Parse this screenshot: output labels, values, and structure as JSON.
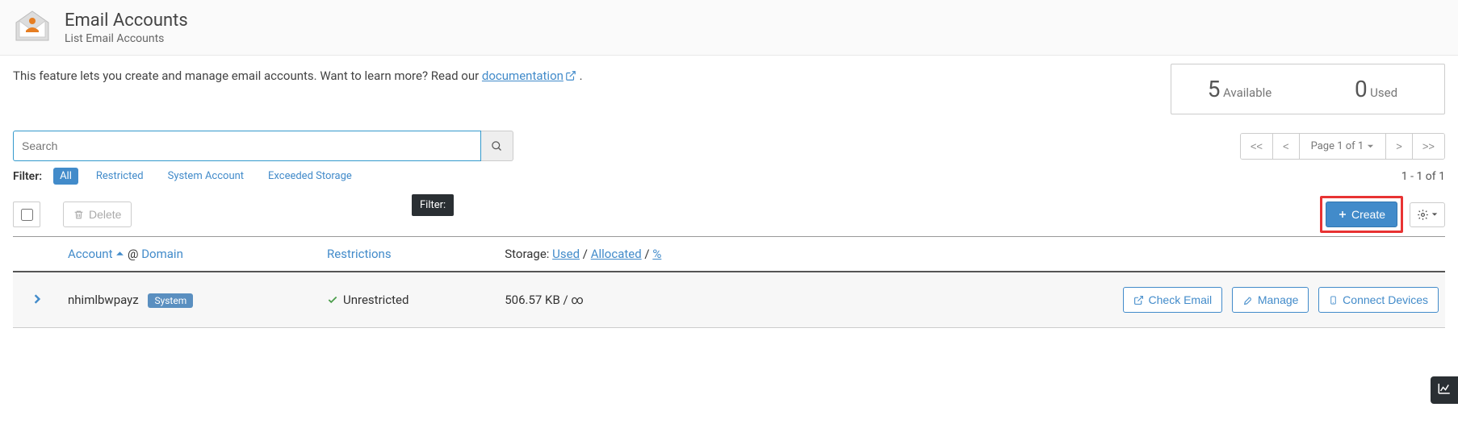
{
  "header": {
    "title": "Email Accounts",
    "subtitle": "List Email Accounts"
  },
  "intro": {
    "text1": "This feature lets you create and manage email accounts. Want to learn more? Read our ",
    "link": "documentation",
    "text2": " ."
  },
  "stats": {
    "available_num": "5",
    "available_lbl": "Available",
    "used_num": "0",
    "used_lbl": "Used"
  },
  "search": {
    "placeholder": "Search"
  },
  "pager": {
    "first": "<<",
    "prev": "<",
    "page_label": "Page 1 of 1",
    "next": ">",
    "last": ">>"
  },
  "filter": {
    "label": "Filter:",
    "all": "All",
    "restricted": "Restricted",
    "system": "System Account",
    "exceeded": "Exceeded Storage",
    "count": "1 - 1 of 1"
  },
  "actions": {
    "delete": "Delete",
    "tooltip": "Filter:",
    "create": "Create"
  },
  "table": {
    "col_account": "Account",
    "col_domain": "Domain",
    "at": "@",
    "col_restrictions": "Restrictions",
    "storage_label": "Storage:",
    "storage_used": "Used",
    "storage_allocated": "Allocated",
    "storage_pct": "%",
    "slash": "/"
  },
  "row": {
    "account": "nhimlbwpayz",
    "badge": "System",
    "restriction": "Unrestricted",
    "storage": "506.57 KB / ∞",
    "check_email": "Check Email",
    "manage": "Manage",
    "connect": "Connect Devices"
  }
}
